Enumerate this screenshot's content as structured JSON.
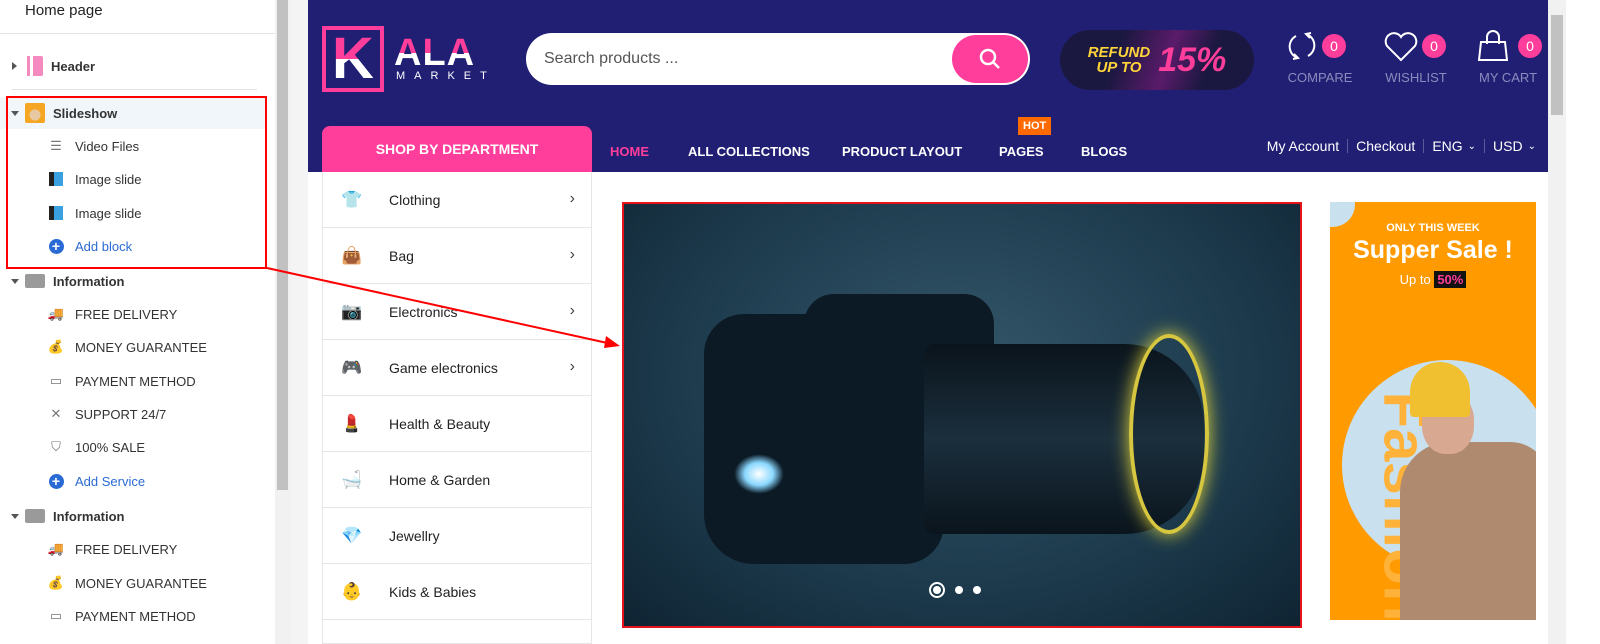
{
  "left_panel": {
    "title": "Home page",
    "sections": [
      {
        "label": "Header",
        "expanded": false,
        "icon": "header-icon"
      },
      {
        "label": "Slideshow",
        "expanded": true,
        "icon": "slideshow-icon",
        "blocks": [
          {
            "label": "Video Files",
            "icon": "text-lines-icon"
          },
          {
            "label": "Image slide",
            "icon": "image-icon"
          },
          {
            "label": "Image slide",
            "icon": "image-icon"
          }
        ],
        "add_label": "Add block"
      },
      {
        "label": "Information",
        "expanded": true,
        "icon": "truck-icon",
        "blocks": [
          {
            "label": "FREE DELIVERY",
            "icon": "truck-icon"
          },
          {
            "label": "MONEY GUARANTEE",
            "icon": "money-bag-icon"
          },
          {
            "label": "PAYMENT METHOD",
            "icon": "wallet-icon"
          },
          {
            "label": "SUPPORT 24/7",
            "icon": "tools-icon"
          },
          {
            "label": "100% SALE",
            "icon": "shield-icon"
          }
        ],
        "add_label": "Add Service"
      },
      {
        "label": "Information",
        "expanded": true,
        "icon": "truck-icon",
        "blocks": [
          {
            "label": "FREE DELIVERY",
            "icon": "truck-icon"
          },
          {
            "label": "MONEY GUARANTEE",
            "icon": "money-bag-icon"
          },
          {
            "label": "PAYMENT METHOD",
            "icon": "wallet-icon"
          }
        ]
      }
    ]
  },
  "site": {
    "logo": {
      "k": "K",
      "ala": "ALA",
      "market": "MARKET"
    },
    "search": {
      "placeholder": "Search products ..."
    },
    "promo": {
      "line1": "REFUND",
      "line2": "UP TO",
      "value": "15%"
    },
    "header_icons": [
      {
        "label": "COMPARE",
        "count": "0",
        "icon": "compare-icon"
      },
      {
        "label": "WISHLIST",
        "count": "0",
        "icon": "heart-icon"
      },
      {
        "label": "MY CART",
        "count": "0",
        "icon": "shopping-bag-icon"
      }
    ],
    "dept_label": "SHOP BY DEPARTMENT",
    "nav": [
      {
        "label": "HOME",
        "active": true
      },
      {
        "label": "ALL COLLECTIONS"
      },
      {
        "label": "PRODUCT LAYOUT"
      },
      {
        "label": "PAGES",
        "badge": "HOT"
      },
      {
        "label": "BLOGS"
      }
    ],
    "account_links": [
      "My Account",
      "Checkout",
      "ENG",
      "USD"
    ],
    "departments": [
      {
        "label": "Clothing",
        "icon": "tshirt-icon",
        "has_sub": true
      },
      {
        "label": "Bag",
        "icon": "bag-icon",
        "has_sub": true
      },
      {
        "label": "Electronics",
        "icon": "camera-icon",
        "has_sub": true
      },
      {
        "label": "Game electronics",
        "icon": "gamepad-icon",
        "has_sub": true
      },
      {
        "label": "Health & Beauty",
        "icon": "cosmetics-icon"
      },
      {
        "label": "Home & Garden",
        "icon": "bathtub-icon"
      },
      {
        "label": "Jewellry",
        "icon": "diamond-icon"
      },
      {
        "label": "Kids & Babies",
        "icon": "baby-icon"
      }
    ],
    "slideshow": {
      "slides": 3,
      "active": 1
    },
    "banner": {
      "kicker": "ONLY THIS WEEK",
      "title": "Supper Sale !",
      "sub": "Up to",
      "value": "50%",
      "watermark": "Fashion"
    },
    "colors": {
      "header": "#201f74",
      "accent": "#ff3d9a",
      "hot": "#ff6a00",
      "banner": "#ff9a00",
      "annotation": "#ff0000"
    }
  }
}
